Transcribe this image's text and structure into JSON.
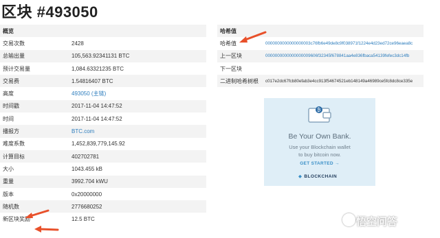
{
  "page": {
    "title": "区块 #493050"
  },
  "summary": {
    "header": "概览",
    "rows": [
      {
        "label": "交易次数",
        "value": "2428"
      },
      {
        "label": "总输出量",
        "value": "105,563.92341131 BTC"
      },
      {
        "label": "预计交易量",
        "value": "1,084.63321235 BTC"
      },
      {
        "label": "交易费",
        "value": "1.54816407 BTC"
      },
      {
        "label": "高度",
        "value": "493050 (主链)"
      },
      {
        "label": "时间戳",
        "value": "2017-11-04 14:47:52"
      },
      {
        "label": "时间",
        "value": "2017-11-04 14:47:52"
      },
      {
        "label": "播报方",
        "value": "BTC.com"
      },
      {
        "label": "难度系数",
        "value": "1,452,839,779,145.92"
      },
      {
        "label": "计算目标",
        "value": "402702781"
      },
      {
        "label": "大小",
        "value": "1043.455 kB"
      },
      {
        "label": "重量",
        "value": "3992.704 kWU"
      },
      {
        "label": "版本",
        "value": "0x20000000"
      },
      {
        "label": "随机数",
        "value": "2776680252"
      },
      {
        "label": "新区块奖励",
        "value": "12.5 BTC"
      }
    ]
  },
  "hashes": {
    "header": "哈希值",
    "rows": [
      {
        "label": "哈希值",
        "value": "0000000000000000003c76fb6e49de8c9f038971f1224e4d23ed72ce96eaea8c"
      },
      {
        "label": "上一区块",
        "value": "0000000000000000009606f32345f678841aa4e836fbaca54139fefec3dc14fb"
      },
      {
        "label": "下一区块",
        "value": ""
      },
      {
        "label": "二进制哈希树根",
        "value": "c017e2dc67fcb80efab3e4cc913f54674521eb148149a46989ce5fc8dc8ce335e"
      }
    ]
  },
  "ad": {
    "title": "Be Your Own Bank.",
    "text_line1": "Use your Blockchain wallet",
    "text_line2": "to buy bitcoin now.",
    "cta": "GET STARTED →",
    "brand": "BLOCKCHAIN"
  },
  "watermark": {
    "text": "悟空问答"
  },
  "colors": {
    "link": "#2d7dbd",
    "arrow": "#e8502a",
    "ad_bg": "#dfeef7"
  }
}
